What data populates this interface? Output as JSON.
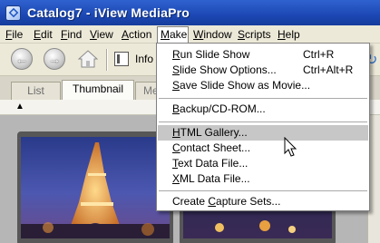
{
  "window": {
    "title": "Catalog7 - iView MediaPro"
  },
  "menubar": {
    "items": [
      {
        "label": "File",
        "key": "F",
        "rest": "ile"
      },
      {
        "label": "Edit",
        "key": "E",
        "rest": "dit"
      },
      {
        "label": "Find",
        "key": "F",
        "rest": "ind"
      },
      {
        "label": "View",
        "key": "V",
        "rest": "iew"
      },
      {
        "label": "Action",
        "key": "A",
        "rest": "ction"
      },
      {
        "label": "Make",
        "key": "M",
        "rest": "ake"
      },
      {
        "label": "Window",
        "key": "W",
        "rest": "indow"
      },
      {
        "label": "Scripts",
        "key": "S",
        "rest": "cripts"
      },
      {
        "label": "Help",
        "key": "H",
        "rest": "elp"
      }
    ]
  },
  "toolbar": {
    "back_icon": "back-arrow-icon",
    "forward_icon": "forward-arrow-icon",
    "home_icon": "home-icon",
    "info_label": "Info"
  },
  "tabs": [
    {
      "label": "List"
    },
    {
      "label": "Thumbnail"
    },
    {
      "label": "Me"
    }
  ],
  "make_menu": {
    "groups": [
      [
        {
          "key": "R",
          "rest": "un Slide Show",
          "shortcut": "Ctrl+R"
        },
        {
          "key": "S",
          "rest": "lide Show Options...",
          "shortcut": "Ctrl+Alt+R"
        },
        {
          "key": "S",
          "rest": "ave Slide Show as Movie...",
          "shortcut": ""
        }
      ],
      [
        {
          "key": "B",
          "rest": "ackup/CD-ROM...",
          "shortcut": ""
        }
      ],
      [
        {
          "key": "H",
          "rest": "TML Gallery...",
          "shortcut": "",
          "highlighted": true
        },
        {
          "key": "C",
          "rest": "ontact Sheet...",
          "shortcut": ""
        },
        {
          "key": "T",
          "rest": "ext Data File...",
          "shortcut": ""
        },
        {
          "key": "X",
          "rest": "ML Data File...",
          "shortcut": ""
        }
      ],
      [
        {
          "pre": "Create ",
          "key": "C",
          "rest": "apture Sets...",
          "shortcut": ""
        }
      ]
    ]
  },
  "colors": {
    "titlebar": "#2154c4",
    "menu_highlight": "#c7c7c7",
    "thumbnail_bg": "#575757"
  }
}
